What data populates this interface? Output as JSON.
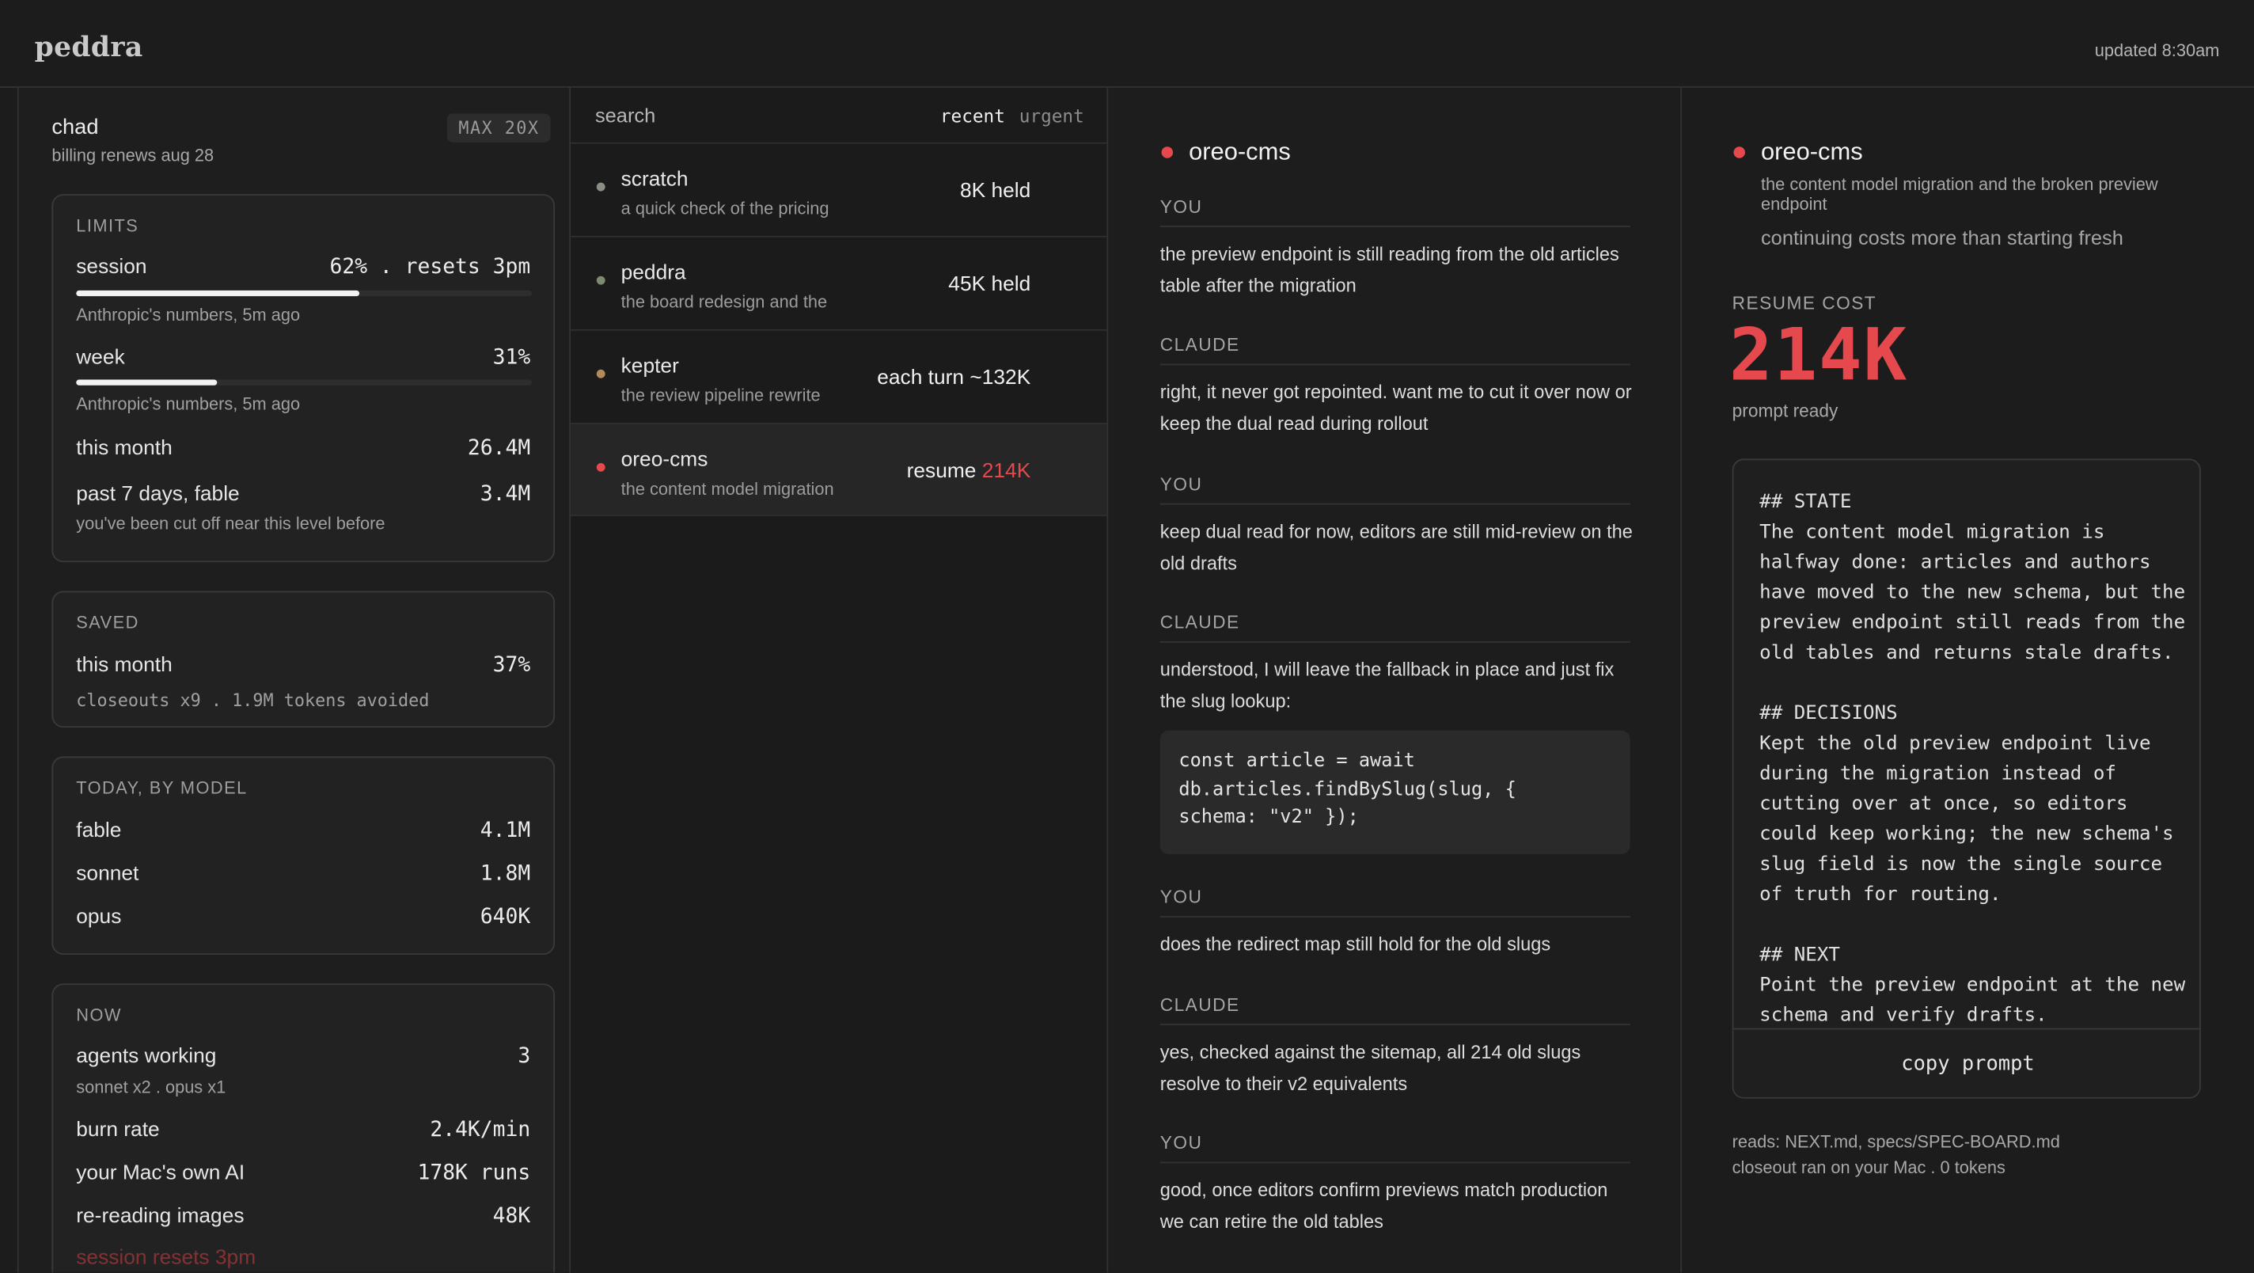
{
  "app": {
    "logo": "peddra",
    "updated": "updated 8:30am"
  },
  "account": {
    "user": "chad",
    "billing": "billing renews aug  28",
    "plan": "MAX 20X"
  },
  "limits": {
    "heading": "LIMITS",
    "session_label": "session",
    "session_value": "62% . resets 3pm",
    "session_progress": 0.62,
    "session_note": "Anthropic's numbers, 5m ago",
    "week_label": "week",
    "week_value": "31%",
    "week_progress": 0.31,
    "week_note": "Anthropic's numbers, 5m ago",
    "month_label": "this month",
    "month_value": "26.4M",
    "past7_label": "past 7 days, fable",
    "past7_value": "3.4M",
    "past7_note": "you've been cut off near this level before"
  },
  "saved": {
    "heading": "SAVED",
    "label": "this month",
    "value": "37%",
    "note": "closeouts x9 . 1.9M tokens avoided"
  },
  "models": {
    "heading": "TODAY, BY MODEL",
    "rows": [
      {
        "label": "fable",
        "value": "4.1M"
      },
      {
        "label": "sonnet",
        "value": "1.8M"
      },
      {
        "label": "opus",
        "value": "640K"
      }
    ]
  },
  "now": {
    "heading": "NOW",
    "agents_label": "agents working",
    "agents_value": "3",
    "agents_note": "sonnet x2 . opus x1",
    "burn_label": "burn rate",
    "burn_value": "2.4K/min",
    "mac_label": "your Mac's own AI",
    "mac_value": "178K runs",
    "images_label": "re-reading images",
    "images_value": "48K",
    "resets": "session resets 3pm"
  },
  "sessions": {
    "search_placeholder": "search",
    "tab_recent": "recent",
    "tab_urgent": "urgent",
    "items": [
      {
        "name": "scratch",
        "desc": "a quick check of the pricing",
        "value": "8K held",
        "dot": "#8a8f86"
      },
      {
        "name": "peddra",
        "desc": "the board redesign and the",
        "value": "45K held",
        "dot": "#7d8a72"
      },
      {
        "name": "kepter",
        "desc": "the review pipeline rewrite",
        "value": "each turn ~132K",
        "dot": "#b48a5a"
      },
      {
        "name": "oreo-cms",
        "desc": "the content model migration",
        "value_prefix": "resume ",
        "value_accent": "214K",
        "dot": "#e5484d"
      }
    ]
  },
  "chat": {
    "title": "oreo-cms",
    "messages": [
      {
        "who": "YOU",
        "text": "the preview endpoint is still reading from the old articles table after the migration"
      },
      {
        "who": "CLAUDE",
        "text": "right, it never got repointed. want me to cut it over now or keep the dual read during rollout"
      },
      {
        "who": "YOU",
        "text": "keep dual read for now, editors are still mid-review on the old drafts"
      },
      {
        "who": "CLAUDE",
        "text": "understood, I will leave the fallback in place and just fix the slug lookup:"
      },
      {
        "who": "YOU",
        "text": "does the redirect map still hold for the old slugs"
      },
      {
        "who": "CLAUDE",
        "text": "yes, checked against the sitemap, all 214 old slugs resolve to their v2 equivalents"
      },
      {
        "who": "YOU",
        "text": "good, once editors confirm previews match production we can retire the old tables"
      }
    ],
    "code": "const article = await\ndb.articles.findBySlug(slug, {\nschema: \"v2\" });"
  },
  "panel": {
    "title": "oreo-cms",
    "desc": "the content model migration and the broken preview endpoint",
    "note": "continuing costs more than starting fresh",
    "cost_label": "RESUME COST",
    "cost_value": "214K",
    "ready": "prompt ready",
    "prompt": "## STATE\nThe content model migration is halfway done: articles and authors have moved to the new schema, but the preview endpoint still reads from the old tables and returns stale drafts.\n\n## DECISIONS\nKept the old preview endpoint live during the migration instead of cutting over at once, so editors could keep working; the new schema's slug field is now the single source of truth for routing.\n\n## NEXT\nPoint the preview endpoint at the new schema and verify drafts.",
    "copy_label": "copy prompt",
    "reads": "reads: NEXT.md, specs/SPEC-BOARD.md",
    "closeout": "closeout ran on your Mac . 0 tokens"
  },
  "colors": {
    "accent": "#e5484d",
    "background": "#1c1c1c"
  }
}
